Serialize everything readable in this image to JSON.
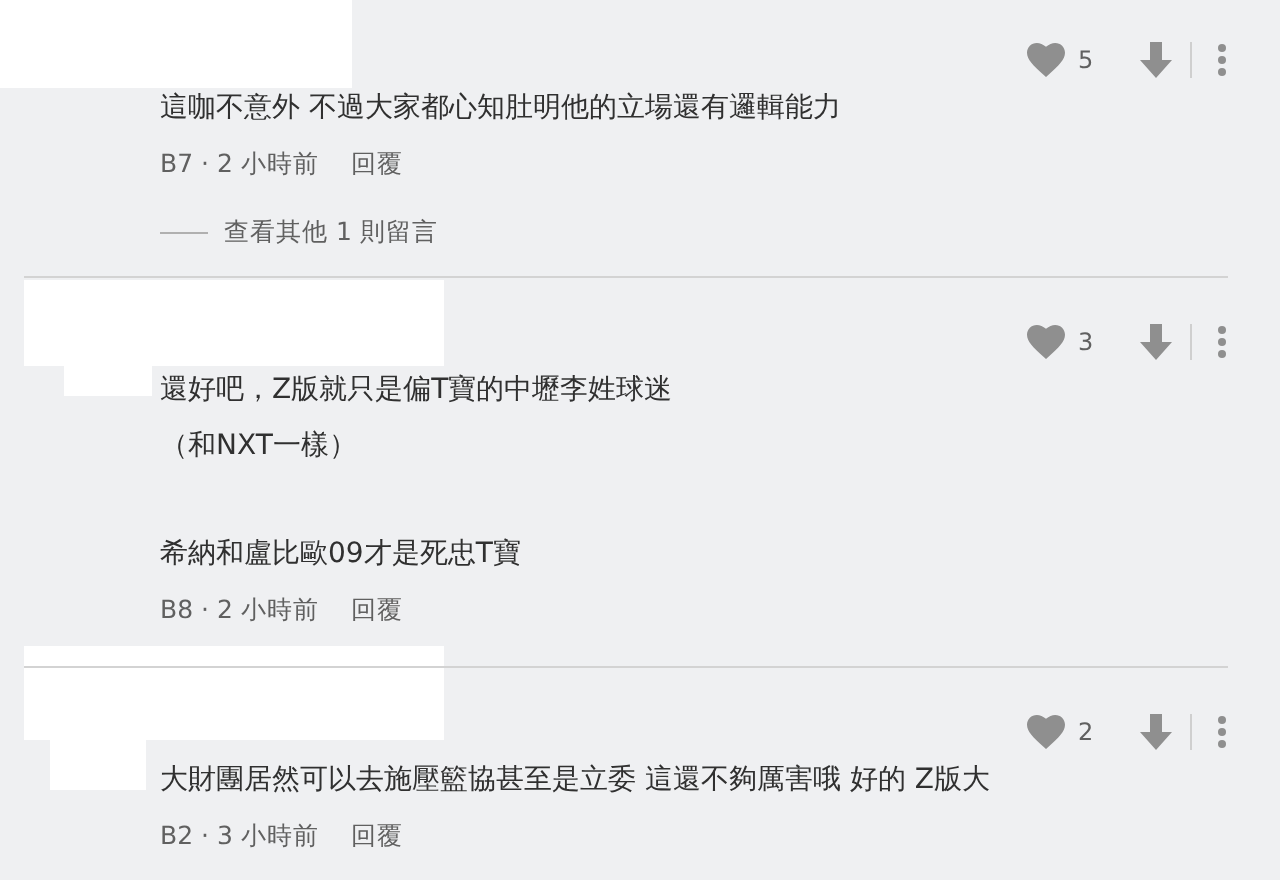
{
  "comments": [
    {
      "likes": "5",
      "paragraphs": [
        [
          "這咖不意外 不過大家都心知肚明他的立場還有邏輯能力"
        ]
      ],
      "meta": "B7 · 2 小時前",
      "reply": "回覆",
      "more_replies": "查看其他 1 則留言"
    },
    {
      "likes": "3",
      "paragraphs": [
        [
          "還好吧，Z版就只是偏T寶的中壢李姓球迷",
          "（和NXT一樣）"
        ],
        [
          "希納和盧比歐09才是死忠T寶"
        ]
      ],
      "meta": "B8 · 2 小時前",
      "reply": "回覆"
    },
    {
      "likes": "2",
      "paragraphs": [
        [
          "大財團居然可以去施壓籃協甚至是立委 這還不夠厲害哦  好的 Z版大"
        ]
      ],
      "meta": "B2 · 3 小時前",
      "reply": "回覆"
    }
  ]
}
